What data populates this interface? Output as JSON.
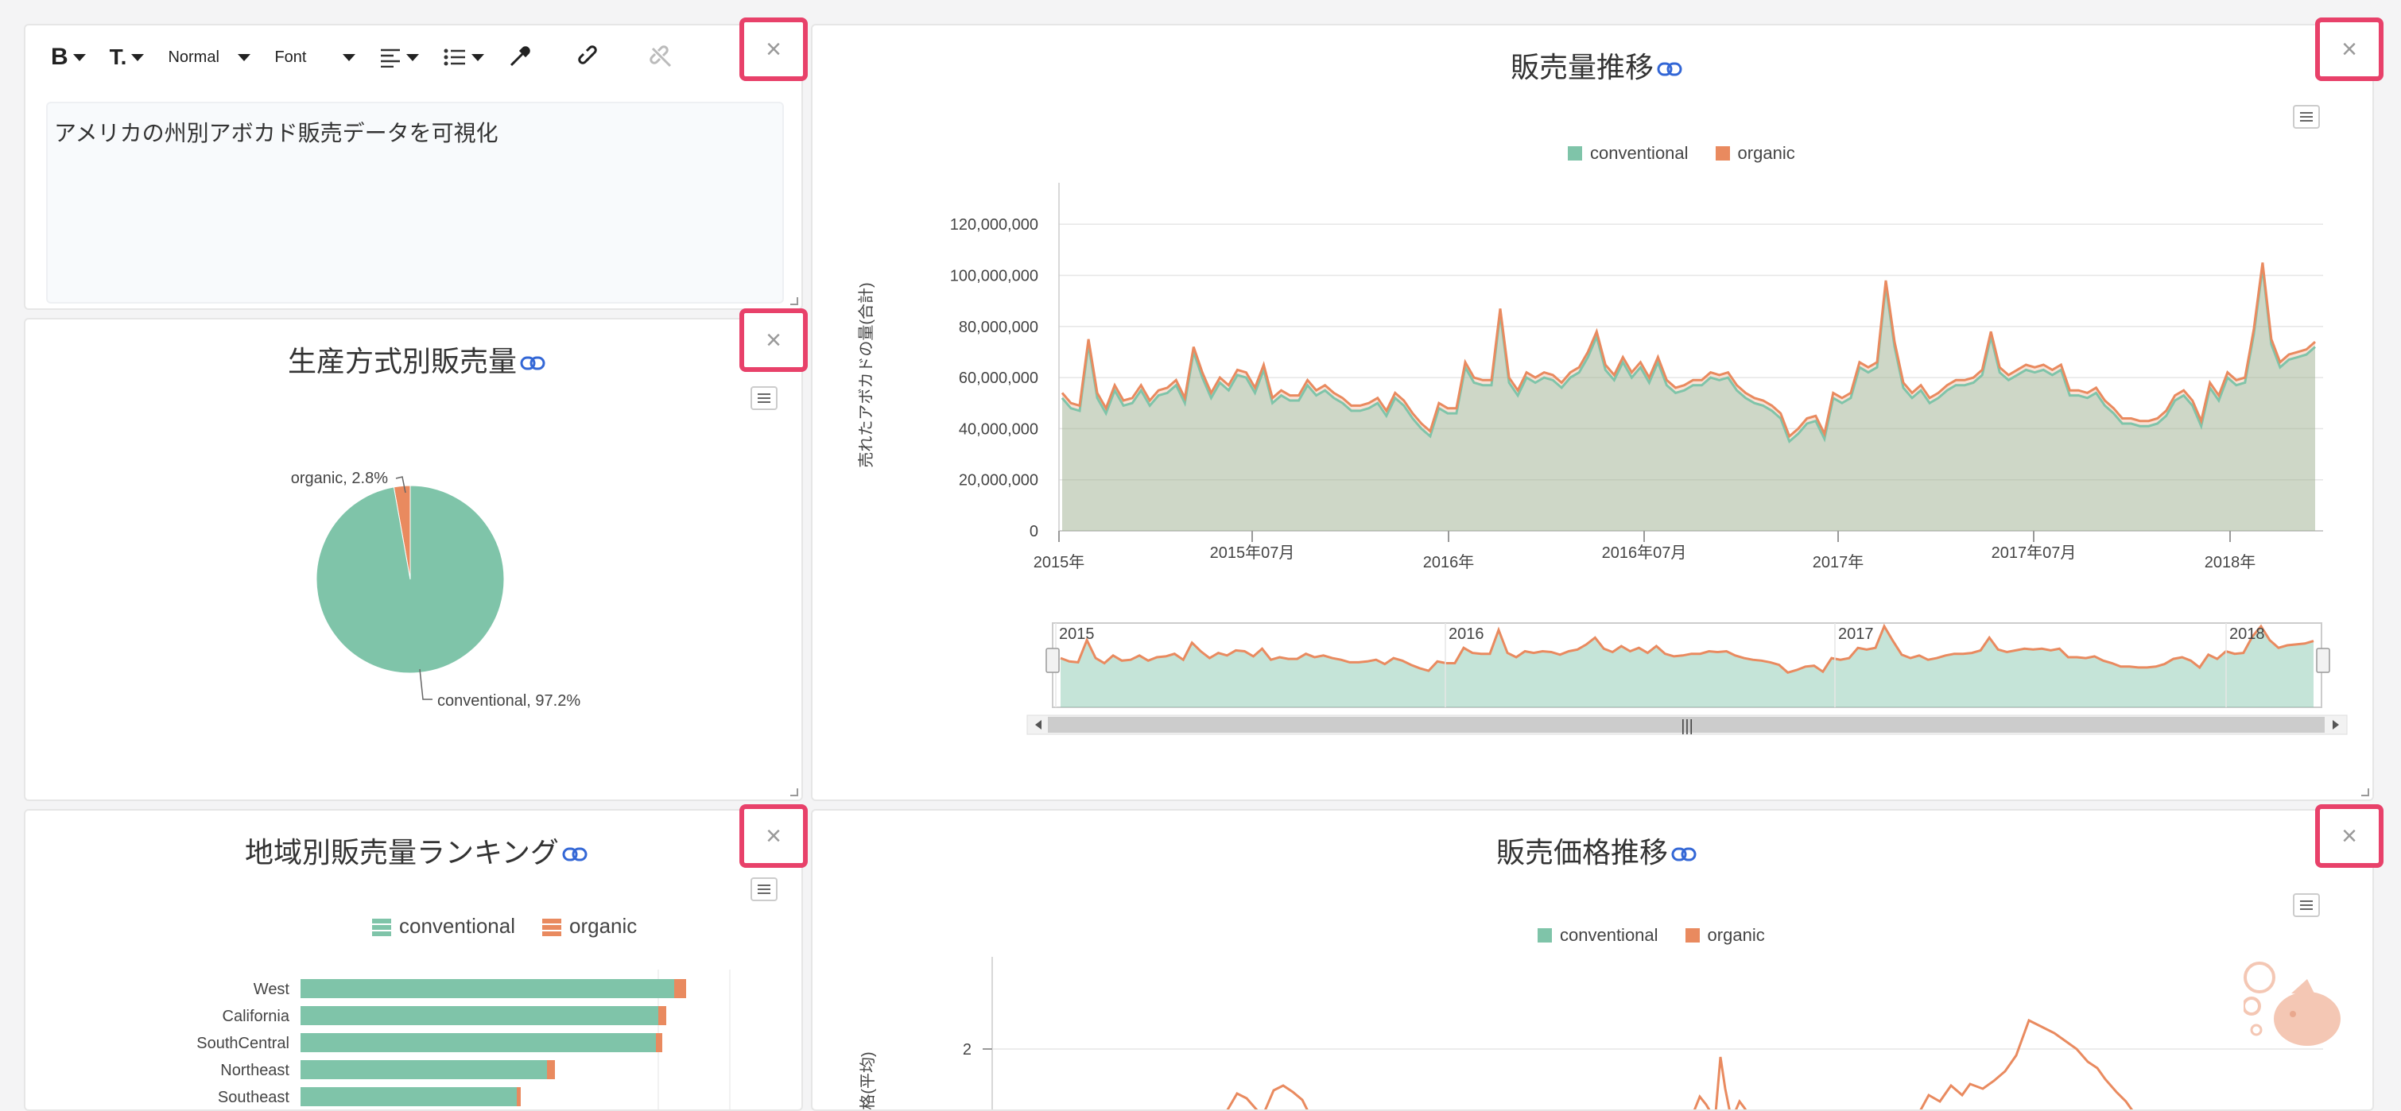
{
  "editor": {
    "toolbar": {
      "bold": "B",
      "text_size": "T.",
      "block_format": "Normal",
      "font": "Font"
    },
    "content": "アメリカの州別アボカド販売データを可視化"
  },
  "colors": {
    "conventional": "#7fc4a9",
    "organic": "#e98a5f",
    "close_highlight": "#e8416a"
  },
  "close_label": "×",
  "pie_panel": {
    "title": "生産方式別販売量",
    "chart_data": {
      "type": "pie",
      "slices": [
        {
          "label": "conventional",
          "value": 97.2
        },
        {
          "label": "organic",
          "value": 2.8
        }
      ],
      "labels": [
        "organic, 2.8%",
        "conventional, 97.2%"
      ]
    }
  },
  "volume_panel": {
    "title": "販売量推移",
    "legend": [
      "conventional",
      "organic"
    ],
    "chart_data": {
      "type": "area",
      "ylabel": "売れたアボカドの量(合計)",
      "ylim": [
        0,
        130000000
      ],
      "yticks": [
        "0",
        "20,000,000",
        "40,000,000",
        "60,000,000",
        "80,000,000",
        "100,000,000",
        "120,000,000"
      ],
      "xticks": [
        "2015年",
        "2015年07月",
        "2016年",
        "2016年07月",
        "2017年",
        "2017年07月",
        "2018年"
      ],
      "x_range": [
        "2015-01",
        "2018-03"
      ],
      "series": [
        {
          "name": "conventional",
          "values": [
            52,
            48,
            47,
            73,
            52,
            46,
            55,
            49,
            50,
            55,
            49,
            53,
            54,
            57,
            50,
            70,
            60,
            52,
            58,
            55,
            61,
            60,
            54,
            63,
            50,
            53,
            51,
            51,
            57,
            53,
            55,
            52,
            50,
            47,
            47,
            48,
            50,
            45,
            52,
            49,
            44,
            40,
            37,
            48,
            46,
            46,
            64,
            58,
            57,
            57,
            85,
            58,
            53,
            60,
            58,
            60,
            59,
            56,
            60,
            62,
            68,
            76,
            63,
            59,
            66,
            60,
            64,
            58,
            66,
            57,
            54,
            55,
            57,
            57,
            60,
            59,
            60,
            55,
            52,
            50,
            49,
            47,
            44,
            35,
            38,
            42,
            43,
            36,
            52,
            50,
            52,
            64,
            62,
            64,
            96,
            72,
            56,
            52,
            55,
            50,
            52,
            55,
            57,
            57,
            58,
            61,
            76,
            62,
            59,
            61,
            63,
            62,
            63,
            61,
            63,
            53,
            53,
            52,
            54,
            49,
            46,
            42,
            42,
            41,
            41,
            42,
            45,
            51,
            53,
            49,
            41,
            56,
            51,
            60,
            57,
            58,
            77,
            103,
            73,
            64,
            67,
            68,
            69,
            72
          ]
        },
        {
          "name": "organic",
          "values": [
            2,
            2,
            2,
            2,
            2,
            2,
            2,
            2,
            2,
            2,
            2,
            2,
            2,
            2,
            2,
            2,
            2,
            2,
            2,
            2,
            2,
            2,
            2,
            2,
            2,
            2,
            2,
            2,
            2,
            2,
            2,
            2,
            2,
            2,
            2,
            2,
            2,
            2,
            2,
            2,
            2,
            2,
            2,
            2,
            2,
            2,
            2,
            2,
            2,
            2,
            2,
            2,
            2,
            2,
            2,
            2,
            2,
            2,
            2,
            2,
            2,
            2,
            2,
            2,
            2,
            2,
            2,
            2,
            2,
            2,
            2,
            2,
            2,
            2,
            2,
            2,
            2,
            2,
            2,
            2,
            2,
            2,
            2,
            2,
            2,
            2,
            2,
            2,
            2,
            2,
            2,
            2,
            2,
            2,
            2,
            2,
            2,
            2,
            2,
            2,
            2,
            2,
            2,
            2,
            2,
            2,
            2,
            2,
            2,
            2,
            2,
            2,
            2,
            2,
            2,
            2,
            2,
            2,
            2,
            2,
            2,
            2,
            2,
            2,
            2,
            2,
            2,
            2,
            2,
            2,
            2,
            2,
            2,
            2,
            2,
            2,
            2,
            2,
            2,
            2,
            2,
            2,
            2,
            2
          ]
        }
      ],
      "navigator_labels": [
        "2015",
        "2016",
        "2017",
        "2018"
      ],
      "navigator_scroll": "|||"
    }
  },
  "ranking_panel": {
    "title": "地域別販売量ランキング",
    "legend": [
      "conventional",
      "organic"
    ],
    "chart_data": {
      "type": "bar",
      "categories": [
        "West",
        "California",
        "SouthCentral",
        "Northeast",
        "Southeast"
      ],
      "series": [
        {
          "name": "conventional",
          "values": [
            470,
            450,
            447,
            310,
            272
          ]
        },
        {
          "name": "organic",
          "values": [
            15,
            10,
            8,
            10,
            5
          ]
        }
      ]
    }
  },
  "price_panel": {
    "title": "販売価格推移",
    "legend": [
      "conventional",
      "organic"
    ],
    "chart_data": {
      "type": "line",
      "ylabel": "価格(平均)",
      "yticks": [
        "2"
      ],
      "series": [
        {
          "name": "organic",
          "values": [
            1.6,
            1.7,
            1.6,
            1.8,
            1.9,
            1.7,
            1.8,
            1.9,
            2.2,
            2.1,
            1.8
          ]
        }
      ]
    }
  }
}
